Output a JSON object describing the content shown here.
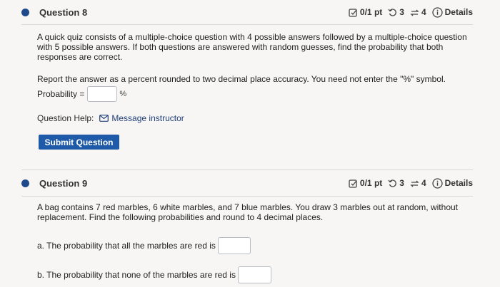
{
  "question8": {
    "title": "Question 8",
    "points": "0/1 pt",
    "attempts": "3",
    "retries": "4",
    "details": "Details",
    "prompt": "A quick quiz consists of a multiple-choice question with 4 possible answers followed by a multiple-choice question with 5 possible answers. If both questions are answered with random guesses, find the probability that both responses are correct.",
    "instruction": "Report the answer as a percent rounded to two decimal place accuracy. You need not enter the \"%\" symbol.",
    "probability_label": "Probability =",
    "percent_symbol": "%",
    "help_label": "Question Help:",
    "message_link": "Message instructor",
    "submit_label": "Submit Question"
  },
  "question9": {
    "title": "Question 9",
    "points": "0/1 pt",
    "attempts": "3",
    "retries": "4",
    "details": "Details",
    "prompt": "A bag contains 7 red marbles, 6 white marbles, and 7 blue marbles. You draw 3 marbles out at random, without replacement. Find the following probabilities and round to 4 decimal places.",
    "part_a": "a. The probability that all the marbles are red is",
    "part_b": "b. The probability that none of the marbles are red is"
  },
  "colors": {
    "accent": "#1e4a8c",
    "button": "#1f5aa8",
    "link": "#1f3f7a"
  }
}
